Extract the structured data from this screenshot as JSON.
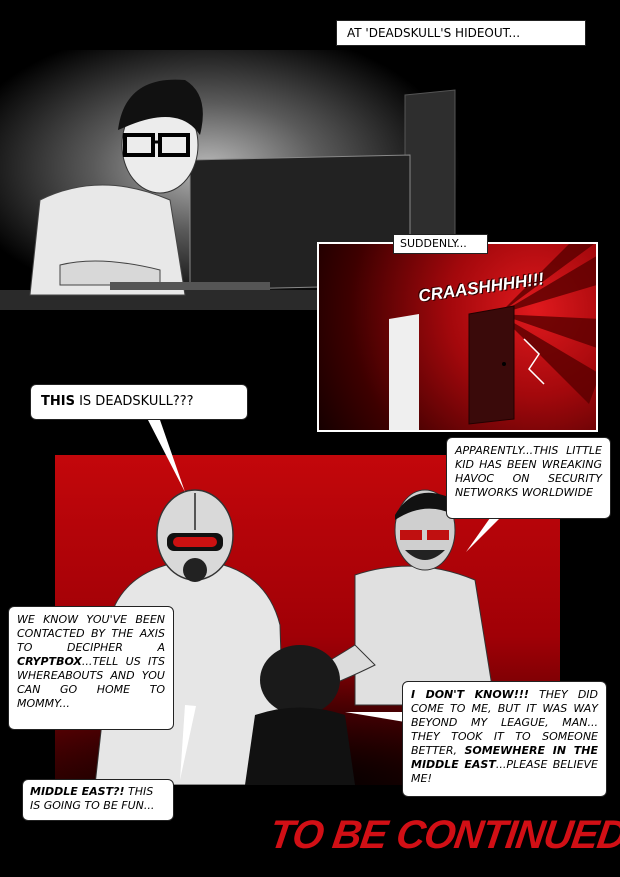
{
  "captions": {
    "hideout": "AT 'DEADSKULL'S HIDEOUT...",
    "suddenly": "SUDDENLY..."
  },
  "sound_effect": "CRAASHHHH!!!",
  "bubbles": {
    "this_is": {
      "bold": "THIS",
      "rest": " IS DEADSKULL???"
    },
    "apparently": "APPARENTLY...THIS LITTLE KID HAS BEEN WREAKING HAVOC ON SECURITY NETWORKS WORLDWIDE",
    "we_know": {
      "part1": "WE KNOW YOU'VE BEEN CONTACTED BY THE AXIS TO DECIPHER A ",
      "bold": "CRYPTBOX",
      "part2": "...TELL US ITS WHEREABOUTS AND YOU CAN GO HOME TO MOMMY..."
    },
    "i_dont_know": {
      "bold1": "I DON'T KNOW!!!",
      "part1": " THEY DID COME TO ME, BUT IT WAS WAY BEYOND MY LEAGUE, MAN... THEY TOOK IT TO SOMEONE BETTER, ",
      "bold2": "SOMEWHERE IN THE MIDDLE EAST",
      "part2": "...PLEASE BELIEVE ME!"
    },
    "middle_east": {
      "bold": "MIDDLE EAST?!",
      "rest": " THIS IS GOING TO BE FUN..."
    }
  },
  "to_be_continued": "TO BE CONTINUED...",
  "colors": {
    "accent_red": "#d10f15",
    "panel_red": "#b0060b",
    "background": "#000000"
  }
}
